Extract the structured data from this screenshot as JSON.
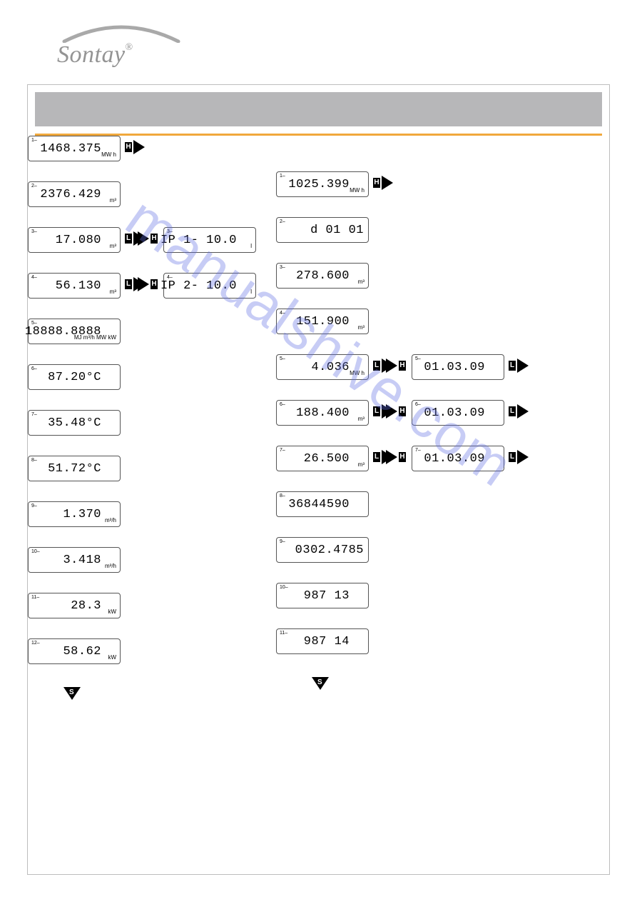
{
  "brand": {
    "name": "Sontay",
    "registered": "®"
  },
  "watermark": "manualshive.com",
  "marks": {
    "H": "H",
    "L": "L",
    "S": "S"
  },
  "left_main": [
    {
      "value": "1468.375",
      "unit": "MW h",
      "after": [
        "H",
        "tri-right"
      ]
    },
    {
      "value": "2376.429",
      "unit": "m³"
    },
    {
      "value": "17.080",
      "unit": "m³",
      "after": [
        "L",
        "tri-right"
      ],
      "side_row": {
        "value": "IP 1-   10.0",
        "unit": "l",
        "before": [
          "tri-right",
          "H"
        ]
      }
    },
    {
      "value": "56.130",
      "unit": "m³",
      "after": [
        "L",
        "tri-right"
      ],
      "side_row": {
        "value": "IP 2-   10.0",
        "unit": "l",
        "before": [
          "tri-right",
          "H"
        ]
      }
    },
    {
      "value": "18888.8888",
      "unit": "MJ m³/h\nMW kW",
      "full_icons": true
    },
    {
      "value": "87.20°C",
      "unit": ""
    },
    {
      "value": "35.48°C",
      "unit": ""
    },
    {
      "value": "51.72°C",
      "unit": ""
    },
    {
      "value": "1.370",
      "unit": "m³/h"
    },
    {
      "value": "3.418",
      "unit": "m³/h"
    },
    {
      "value": "28.3",
      "unit": "kW"
    },
    {
      "value": "58.62",
      "unit": "kW"
    }
  ],
  "left_end_mark": "tri-down-S",
  "right_main": [
    {
      "value": "1025.399",
      "unit": "MW h",
      "after": [
        "H",
        "tri-right"
      ]
    },
    {
      "value": "d    01 01",
      "unit": ""
    },
    {
      "value": "278.600",
      "unit": "m³"
    },
    {
      "value": "151.900",
      "unit": "m³"
    },
    {
      "value": "4.036",
      "unit": "MW h",
      "after": [
        "L",
        "tri-right"
      ],
      "side_row": {
        "value": "01.03.09",
        "before": [
          "tri-right",
          "H"
        ],
        "after": [
          "L",
          "tri-right"
        ]
      }
    },
    {
      "value": "188.400",
      "unit": "m³",
      "after": [
        "L",
        "tri-right"
      ],
      "side_row": {
        "value": "01.03.09",
        "before": [
          "tri-right",
          "H"
        ],
        "after": [
          "L",
          "tri-right"
        ]
      }
    },
    {
      "value": "26.500",
      "unit": "m³",
      "after": [
        "L",
        "tri-right"
      ],
      "side_row": {
        "value": "01.03.09",
        "before": [
          "tri-right",
          "H"
        ],
        "after": [
          "L",
          "tri-right"
        ]
      }
    },
    {
      "value": "36844590",
      "unit": ""
    },
    {
      "value": "0302.4785",
      "unit": ""
    },
    {
      "value": "987 13",
      "unit": ""
    },
    {
      "value": "987 14",
      "unit": ""
    }
  ],
  "right_end_mark": "tri-down-S"
}
